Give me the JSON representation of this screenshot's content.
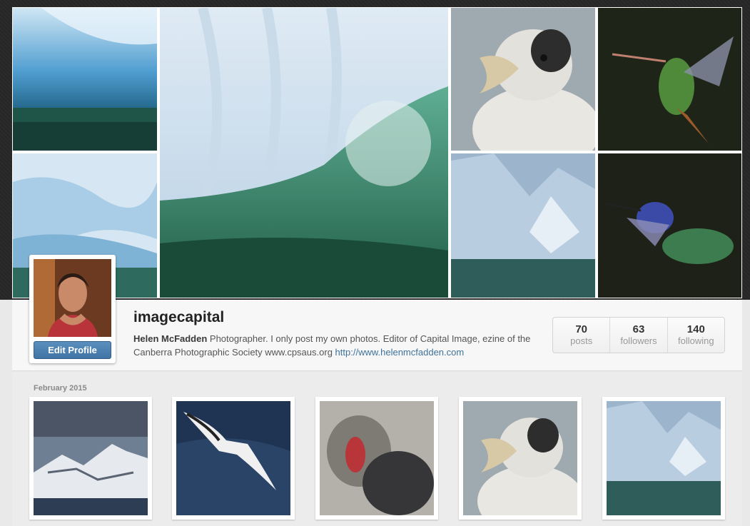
{
  "profile": {
    "username": "imagecapital",
    "display_name": "Helen McFadden",
    "bio": " Photographer. I only post my own photos. Editor of Capital Image, ezine of the Canberra Photographic Society www.cpsaus.org ",
    "website": "http://www.helenmcfadden.com",
    "edit_label": "Edit Profile"
  },
  "stats": {
    "posts": {
      "value": "70",
      "label": "posts"
    },
    "followers": {
      "value": "63",
      "label": "followers"
    },
    "following": {
      "value": "140",
      "label": "following"
    }
  },
  "feed": {
    "month_label": "February 2015"
  },
  "colors": {
    "accent": "#3f729b",
    "button": "#4a7fb0"
  }
}
